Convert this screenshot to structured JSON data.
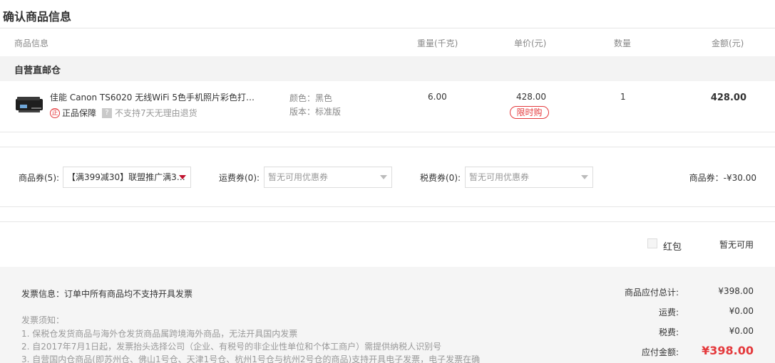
{
  "page": {
    "title": "确认商品信息"
  },
  "columns": {
    "product": "商品信息",
    "weight": "重量(千克)",
    "price": "单价(元)",
    "qty": "数量",
    "amount": "金额(元)"
  },
  "store": {
    "name": "自营直邮仓"
  },
  "item": {
    "name": "佳能 Canon TS6020 无线WiFi 5色手机照片彩色打…",
    "guarantee": "正品保障",
    "guarantee_icon": "正",
    "no_return": "不支持7天无理由退货",
    "help_icon": "?",
    "color": "颜色：黑色",
    "version": "版本：标准版",
    "weight": "6.00",
    "price": "428.00",
    "tag": "限时购",
    "qty": "1",
    "amount": "428.00"
  },
  "coupons": {
    "product_label": "商品券(5):",
    "product_selected": "【满399减30】联盟推广满3…",
    "shipping_label": "运费券(0):",
    "shipping_placeholder": "暂无可用优惠券",
    "tax_label": "税费券(0):",
    "tax_placeholder": "暂无可用优惠券",
    "summary": "商品券：-¥30.00"
  },
  "hongbao": {
    "label": "红包",
    "status": "暂无可用"
  },
  "invoice": {
    "info": "发票信息：订单中所有商品均不支持开具发票",
    "notice_title": "发票须知：",
    "notices": [
      "1. 保税仓发货商品与海外仓发货商品属跨境海外商品，无法开具国内发票",
      "2. 自2017年7月1日起，发票抬头选择公司（企业、有税号的非企业性单位和个体工商户）需提供纳税人识别号",
      "3. 自营国内仓商品(即苏州仓、佛山1号仓、天津1号仓、杭州1号仓与杭州2号仓的商品)支持开具电子发票，电子发票在确"
    ]
  },
  "summary": {
    "total_label": "商品应付总计:",
    "total_value": "¥398.00",
    "shipping_label": "运费:",
    "shipping_value": "¥0.00",
    "tax_label": "税费:",
    "tax_value": "¥0.00",
    "pay_label": "应付金额:",
    "pay_value": "¥398.00"
  },
  "colors": {
    "accent": "#e4393c",
    "caret": "#c0122e",
    "band": "#f3f3f3"
  }
}
